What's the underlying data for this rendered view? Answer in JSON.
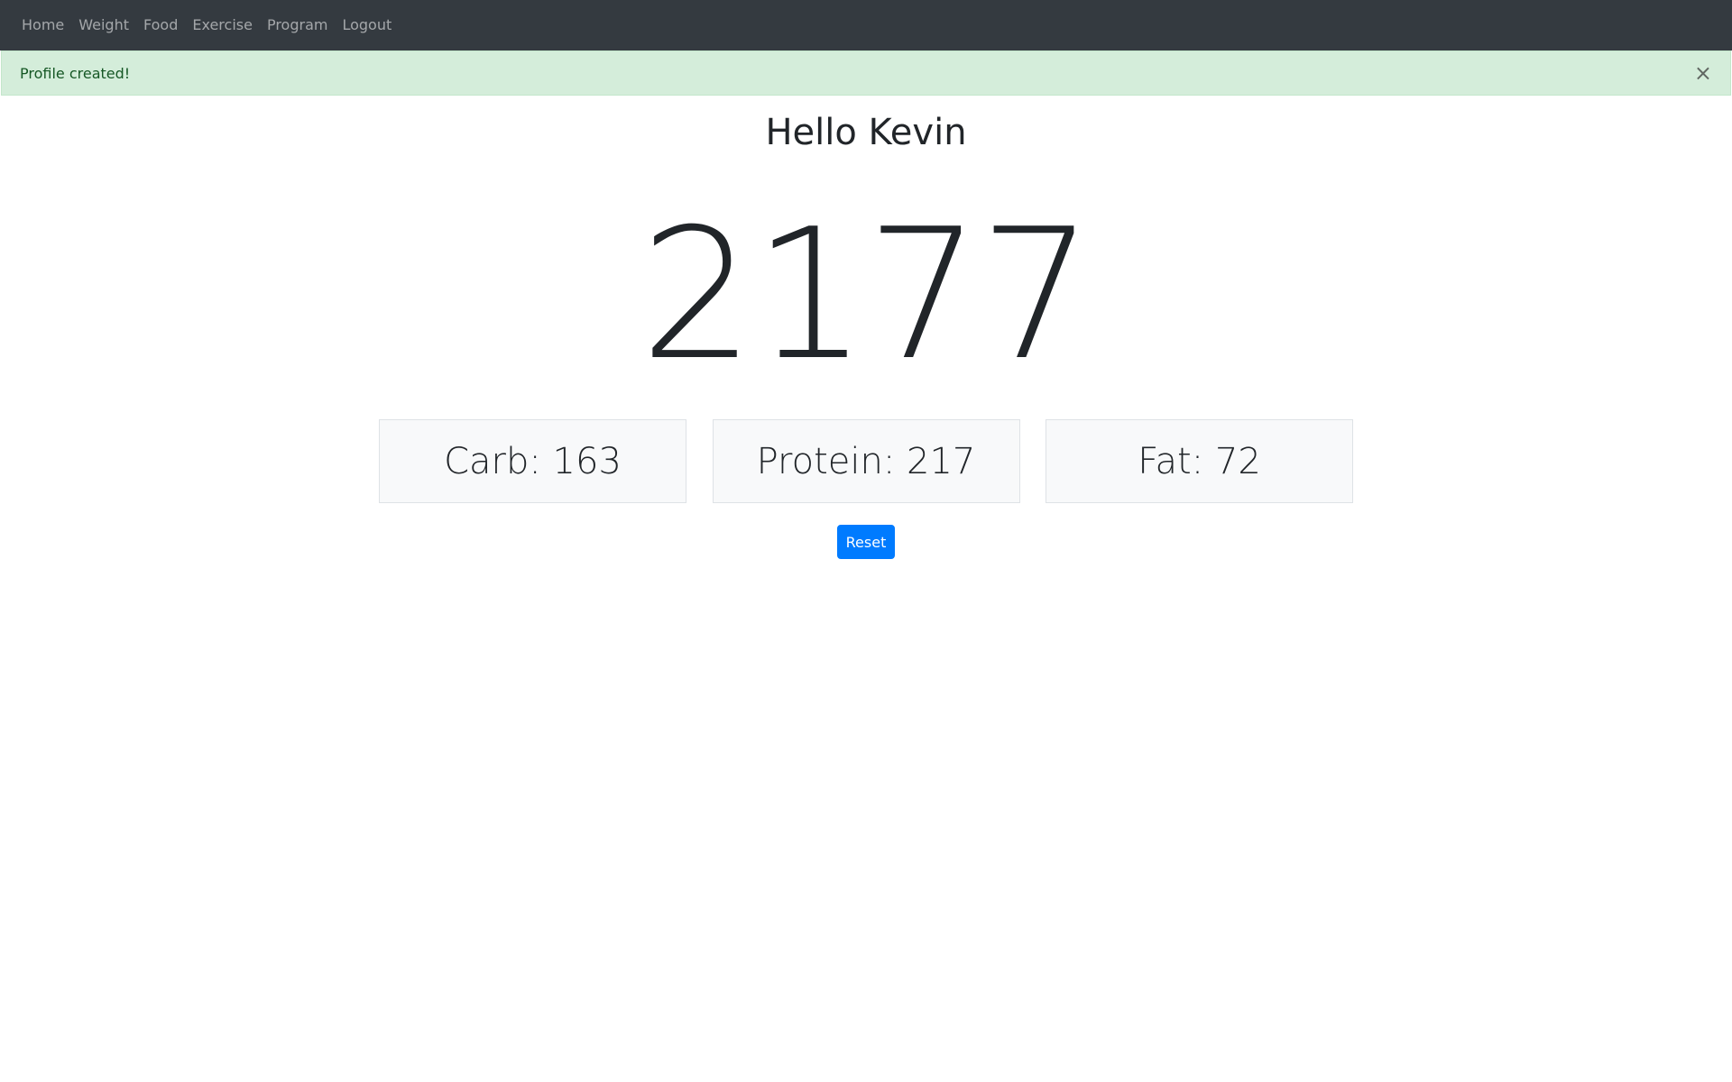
{
  "nav": {
    "items": [
      {
        "label": "Home"
      },
      {
        "label": "Weight"
      },
      {
        "label": "Food"
      },
      {
        "label": "Exercise"
      },
      {
        "label": "Program"
      },
      {
        "label": "Logout"
      }
    ]
  },
  "alert": {
    "message": "Profile created!",
    "close_glyph": "×"
  },
  "main": {
    "greeting": "Hello Kevin",
    "calories": "2177",
    "macros": [
      {
        "label": "Carb: 163"
      },
      {
        "label": "Protein: 217"
      },
      {
        "label": "Fat: 72"
      }
    ],
    "reset_label": "Reset"
  },
  "colors": {
    "navbar_bg": "#343a40",
    "alert_bg": "#d4edda",
    "alert_text": "#155724",
    "card_bg": "#f8f9fa",
    "primary": "#007bff"
  }
}
